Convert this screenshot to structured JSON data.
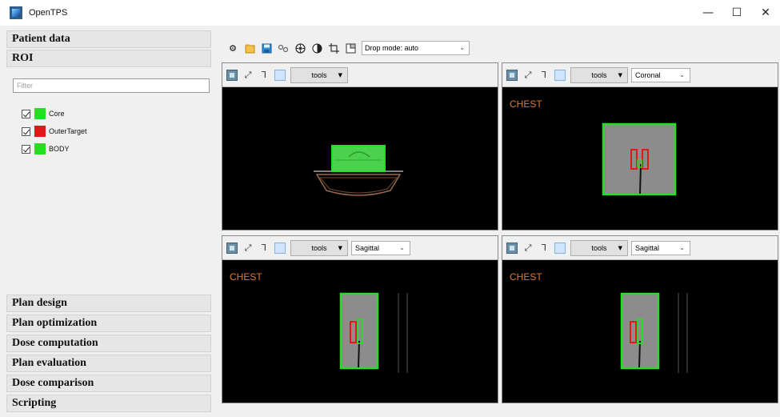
{
  "window": {
    "title": "OpenTPS",
    "minimize_glyph": "—",
    "maximize_glyph": "☐",
    "close_glyph": "✕"
  },
  "sidebar": {
    "patient_data": "Patient data",
    "roi": "ROI",
    "filter_placeholder": "Filter",
    "roi_items": [
      {
        "label": "Core",
        "color": "#22e022",
        "checked": true
      },
      {
        "label": "OuterTarget",
        "color": "#e01818",
        "checked": true
      },
      {
        "label": "BODY",
        "color": "#22e022",
        "checked": true
      }
    ],
    "sections": [
      {
        "label": "Plan design"
      },
      {
        "label": "Plan optimization"
      },
      {
        "label": "Dose computation"
      },
      {
        "label": "Plan evaluation"
      },
      {
        "label": "Dose comparison"
      },
      {
        "label": "Scripting"
      }
    ]
  },
  "toolbar": {
    "icons": [
      "gear-icon",
      "folder-icon",
      "save-icon",
      "link-icon",
      "target-icon",
      "contrast-icon",
      "crop-icon",
      "layout-icon"
    ],
    "drop_mode": "Drop mode: auto"
  },
  "viewers": [
    {
      "name": "viewer-top-left",
      "tools_label": "tools",
      "view": null,
      "overlay_label": null
    },
    {
      "name": "viewer-top-right",
      "tools_label": "tools",
      "view": "Coronal",
      "overlay_label": "CHEST"
    },
    {
      "name": "viewer-bottom-left",
      "tools_label": "tools",
      "view": "Sagittal",
      "overlay_label": "CHEST"
    },
    {
      "name": "viewer-bottom-right",
      "tools_label": "tools",
      "view": "Sagittal",
      "overlay_label": "CHEST"
    }
  ],
  "colors": {
    "contour_green": "#22e022",
    "contour_red": "#e01818",
    "overlay_text": "#e07a2c",
    "viewer_bg": "#000000"
  }
}
